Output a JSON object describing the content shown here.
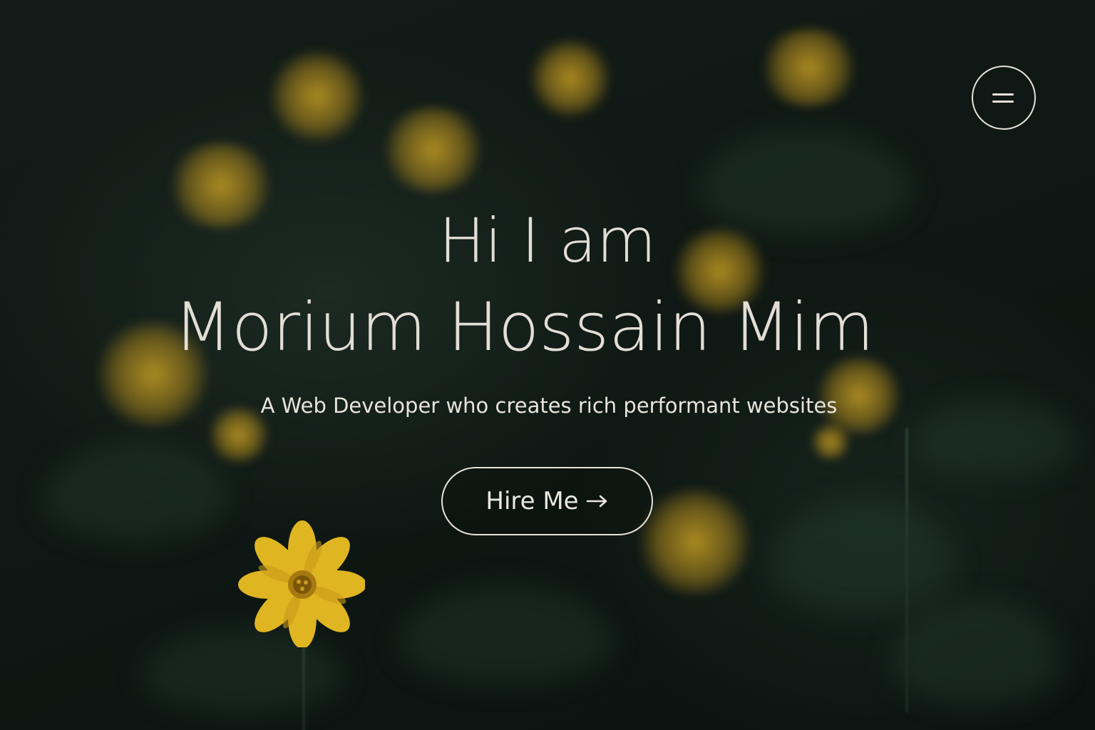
{
  "hero": {
    "greeting": "Hi I am",
    "name": "Morium Hossain Mim",
    "tagline": "A Web Developer who creates rich performant websites",
    "cta_label": "Hire Me",
    "cta_icon": "arrow-right-icon"
  },
  "menu": {
    "icon": "menu-icon"
  },
  "colors": {
    "background": "#0f1714",
    "text": "#e3ded5",
    "flower": "#d6aa24"
  }
}
